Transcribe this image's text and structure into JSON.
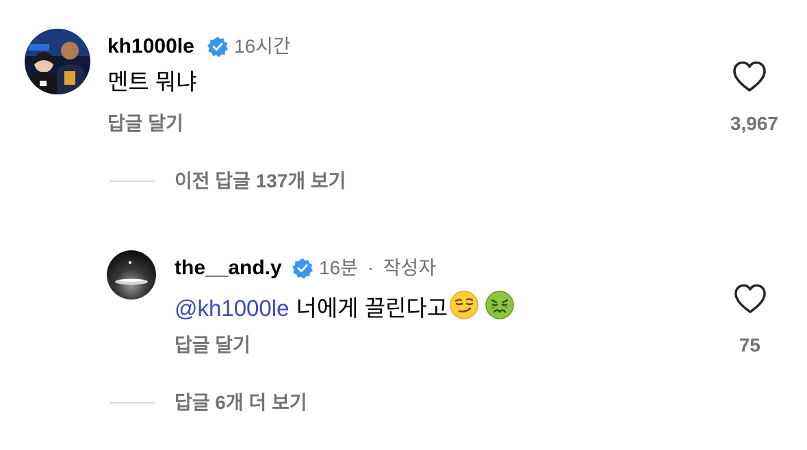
{
  "comments": [
    {
      "username": "kh1000le",
      "verified": true,
      "time": "16시간",
      "text": "멘트 뭐냐",
      "reply_label": "답글 달기",
      "like_count": "3,967",
      "like_icon": "heart-outline-icon"
    },
    {
      "username": "the__and.y",
      "verified": true,
      "time": "16분",
      "separator": "·",
      "author_badge": "작성자",
      "mention": "@kh1000le",
      "text": "너에게 끌린다고",
      "emojis": [
        "smirking-face-emoji",
        "nauseated-face-emoji"
      ],
      "reply_label": "답글 달기",
      "like_count": "75",
      "like_icon": "heart-outline-icon"
    }
  ],
  "view_previous_replies": "이전 답글 137개 보기",
  "view_more_replies": "답글 6개 더 보기",
  "colors": {
    "verified_badge": "#3797f0",
    "mention": "#3b4bb8",
    "secondary_text": "#737373",
    "divider": "#dbdbdb"
  }
}
